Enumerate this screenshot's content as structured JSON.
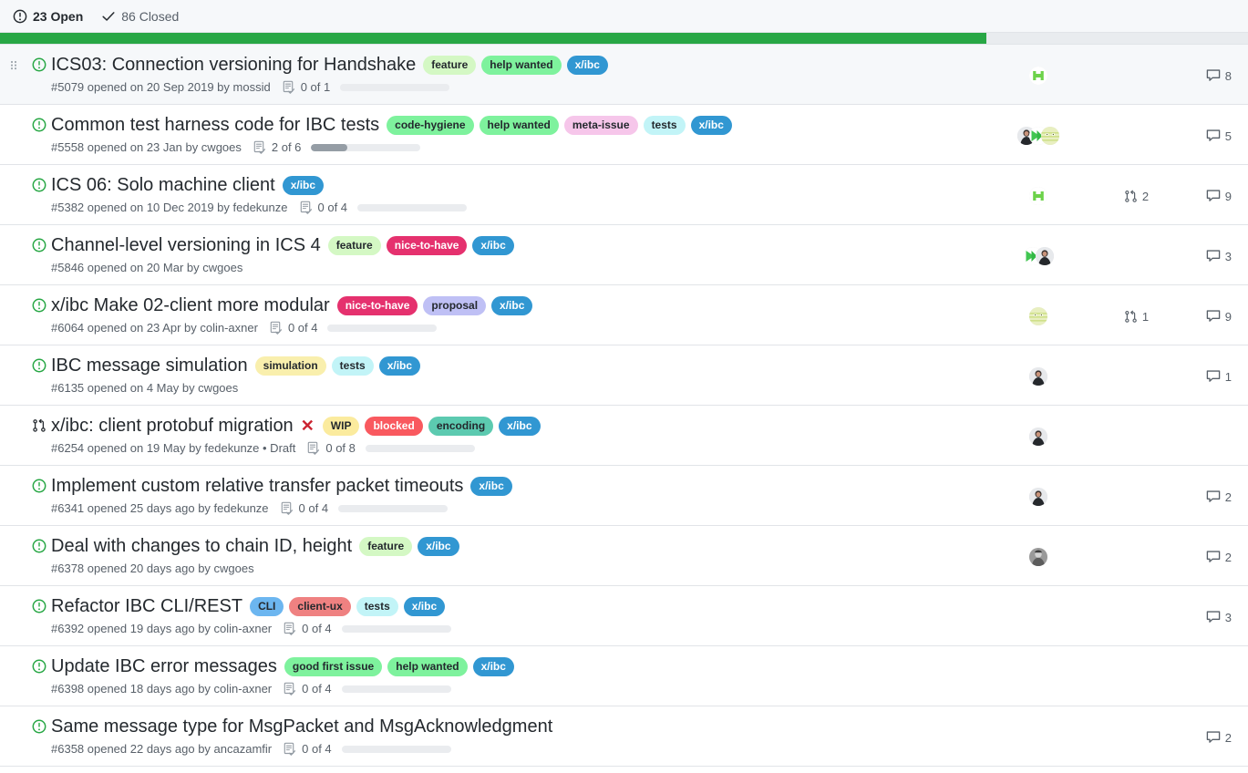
{
  "filter_bar": {
    "open": {
      "icon": "issue-opened-icon",
      "label": "23 Open"
    },
    "closed": {
      "icon": "check-icon",
      "label": "86 Closed"
    }
  },
  "progress_strip": {
    "percent": 79,
    "fill_color": "#28a745",
    "track_color": "#e9ecef"
  },
  "label_colors": {
    "feature": {
      "bg": "#d4f8c4",
      "fg": "#24292e"
    },
    "help wanted": {
      "bg": "#7ef29d",
      "fg": "#24292e"
    },
    "x/ibc": {
      "bg": "#3197d2",
      "fg": "#ffffff"
    },
    "code-hygiene": {
      "bg": "#7ef29d",
      "fg": "#24292e"
    },
    "meta-issue": {
      "bg": "#f6c6ea",
      "fg": "#24292e"
    },
    "tests": {
      "bg": "#c2f4f7",
      "fg": "#24292e"
    },
    "nice-to-have": {
      "bg": "#e5316e",
      "fg": "#ffffff"
    },
    "proposal": {
      "bg": "#bfc0f5",
      "fg": "#24292e"
    },
    "simulation": {
      "bg": "#f9efad",
      "fg": "#24292e"
    },
    "WIP": {
      "bg": "#fbeb9e",
      "fg": "#24292e"
    },
    "blocked": {
      "bg": "#f9595f",
      "fg": "#ffffff"
    },
    "encoding": {
      "bg": "#5ccab0",
      "fg": "#24292e"
    },
    "CLI": {
      "bg": "#6cb6f0",
      "fg": "#24292e"
    },
    "client-ux": {
      "bg": "#ef8181",
      "fg": "#24292e"
    },
    "good first issue": {
      "bg": "#7ef29d",
      "fg": "#24292e"
    }
  },
  "issues": [
    {
      "highlight": true,
      "drag_handle": true,
      "type": "issue-opened",
      "title": "ICS03: Connection versioning for Handshake",
      "closed_mark": false,
      "labels": [
        "feature",
        "help wanted",
        "x/ibc"
      ],
      "meta": "#5079 opened on 20 Sep 2019 by mossid",
      "number": "#5079",
      "author": "mossid",
      "tasks": {
        "show": true,
        "text": "0 of 1",
        "done": 0,
        "total": 1
      },
      "avatars": [
        "hexagon-green"
      ],
      "pull_requests": null,
      "comments": "8"
    },
    {
      "highlight": false,
      "drag_handle": false,
      "type": "issue-opened",
      "title": "Common test harness code for IBC tests",
      "closed_mark": false,
      "labels": [
        "code-hygiene",
        "help wanted",
        "meta-issue",
        "tests",
        "x/ibc"
      ],
      "meta": "#5558 opened on 23 Jan by cwgoes",
      "number": "#5558",
      "author": "cwgoes",
      "tasks": {
        "show": true,
        "text": "2 of 6",
        "done": 2,
        "total": 6
      },
      "avatars": [
        "person-dark",
        "arrow-green",
        "face-pale"
      ],
      "pull_requests": null,
      "comments": "5"
    },
    {
      "highlight": false,
      "drag_handle": false,
      "type": "issue-opened",
      "title": "ICS 06: Solo machine client",
      "closed_mark": false,
      "labels": [
        "x/ibc"
      ],
      "meta": "#5382 opened on 10 Dec 2019 by fedekunze",
      "number": "#5382",
      "author": "fedekunze",
      "tasks": {
        "show": true,
        "text": "0 of 4",
        "done": 0,
        "total": 4
      },
      "avatars": [
        "hexagon-green"
      ],
      "pull_requests": "2",
      "comments": "9"
    },
    {
      "highlight": false,
      "drag_handle": false,
      "type": "issue-opened",
      "title": "Channel-level versioning in ICS 4",
      "closed_mark": false,
      "labels": [
        "feature",
        "nice-to-have",
        "x/ibc"
      ],
      "meta": "#5846 opened on 20 Mar by cwgoes",
      "number": "#5846",
      "author": "cwgoes",
      "tasks": {
        "show": false,
        "text": "",
        "done": 0,
        "total": 0
      },
      "avatars": [
        "arrow-green",
        "person-dark"
      ],
      "pull_requests": null,
      "comments": "3"
    },
    {
      "highlight": false,
      "drag_handle": false,
      "type": "issue-opened",
      "title": "x/ibc Make 02-client more modular",
      "closed_mark": false,
      "labels": [
        "nice-to-have",
        "proposal",
        "x/ibc"
      ],
      "meta": "#6064 opened on 23 Apr by colin-axner",
      "number": "#6064",
      "author": "colin-axner",
      "tasks": {
        "show": true,
        "text": "0 of 4",
        "done": 0,
        "total": 4
      },
      "avatars": [
        "face-pale"
      ],
      "pull_requests": "1",
      "comments": "9"
    },
    {
      "highlight": false,
      "drag_handle": false,
      "type": "issue-opened",
      "title": "IBC message simulation",
      "closed_mark": false,
      "labels": [
        "simulation",
        "tests",
        "x/ibc"
      ],
      "meta": "#6135 opened on 4 May by cwgoes",
      "number": "#6135",
      "author": "cwgoes",
      "tasks": {
        "show": false,
        "text": "",
        "done": 0,
        "total": 0
      },
      "avatars": [
        "person-dark"
      ],
      "pull_requests": null,
      "comments": "1"
    },
    {
      "highlight": false,
      "drag_handle": false,
      "type": "pull-request",
      "title": "x/ibc: client protobuf migration",
      "closed_mark": true,
      "labels": [
        "WIP",
        "blocked",
        "encoding",
        "x/ibc"
      ],
      "meta": "#6254 opened on 19 May by fedekunze • Draft",
      "number": "#6254",
      "author": "fedekunze",
      "tasks": {
        "show": true,
        "text": "0 of 8",
        "done": 0,
        "total": 8
      },
      "avatars": [
        "person-dark"
      ],
      "pull_requests": null,
      "comments": null
    },
    {
      "highlight": false,
      "drag_handle": false,
      "type": "issue-opened",
      "title": "Implement custom relative transfer packet timeouts",
      "closed_mark": false,
      "labels": [
        "x/ibc"
      ],
      "meta": "#6341 opened 25 days ago by fedekunze",
      "number": "#6341",
      "author": "fedekunze",
      "tasks": {
        "show": true,
        "text": "0 of 4",
        "done": 0,
        "total": 4
      },
      "avatars": [
        "person-dark"
      ],
      "pull_requests": null,
      "comments": "2"
    },
    {
      "highlight": false,
      "drag_handle": false,
      "type": "issue-opened",
      "title": "Deal with changes to chain ID, height",
      "closed_mark": false,
      "labels": [
        "feature",
        "x/ibc"
      ],
      "meta": "#6378 opened 20 days ago by cwgoes",
      "number": "#6378",
      "author": "cwgoes",
      "tasks": {
        "show": false,
        "text": "",
        "done": 0,
        "total": 0
      },
      "avatars": [
        "person-gray"
      ],
      "pull_requests": null,
      "comments": "2"
    },
    {
      "highlight": false,
      "drag_handle": false,
      "type": "issue-opened",
      "title": "Refactor IBC CLI/REST",
      "closed_mark": false,
      "labels": [
        "CLI",
        "client-ux",
        "tests",
        "x/ibc"
      ],
      "meta": "#6392 opened 19 days ago by colin-axner",
      "number": "#6392",
      "author": "colin-axner",
      "tasks": {
        "show": true,
        "text": "0 of 4",
        "done": 0,
        "total": 4
      },
      "avatars": [],
      "pull_requests": null,
      "comments": "3"
    },
    {
      "highlight": false,
      "drag_handle": false,
      "type": "issue-opened",
      "title": "Update IBC error messages",
      "closed_mark": false,
      "labels": [
        "good first issue",
        "help wanted",
        "x/ibc"
      ],
      "meta": "#6398 opened 18 days ago by colin-axner",
      "number": "#6398",
      "author": "colin-axner",
      "tasks": {
        "show": true,
        "text": "0 of 4",
        "done": 0,
        "total": 4
      },
      "avatars": [],
      "pull_requests": null,
      "comments": null
    },
    {
      "highlight": false,
      "drag_handle": false,
      "type": "issue-opened",
      "title": "Same message type for MsgPacket and MsgAcknowledgment",
      "closed_mark": false,
      "labels": [],
      "meta": "#6358 opened 22 days ago by ancazamfir",
      "number": "#6358",
      "author": "ancazamfir",
      "tasks": {
        "show": true,
        "text": "0 of 4",
        "done": 0,
        "total": 4
      },
      "avatars": [],
      "pull_requests": null,
      "comments": "2"
    }
  ]
}
